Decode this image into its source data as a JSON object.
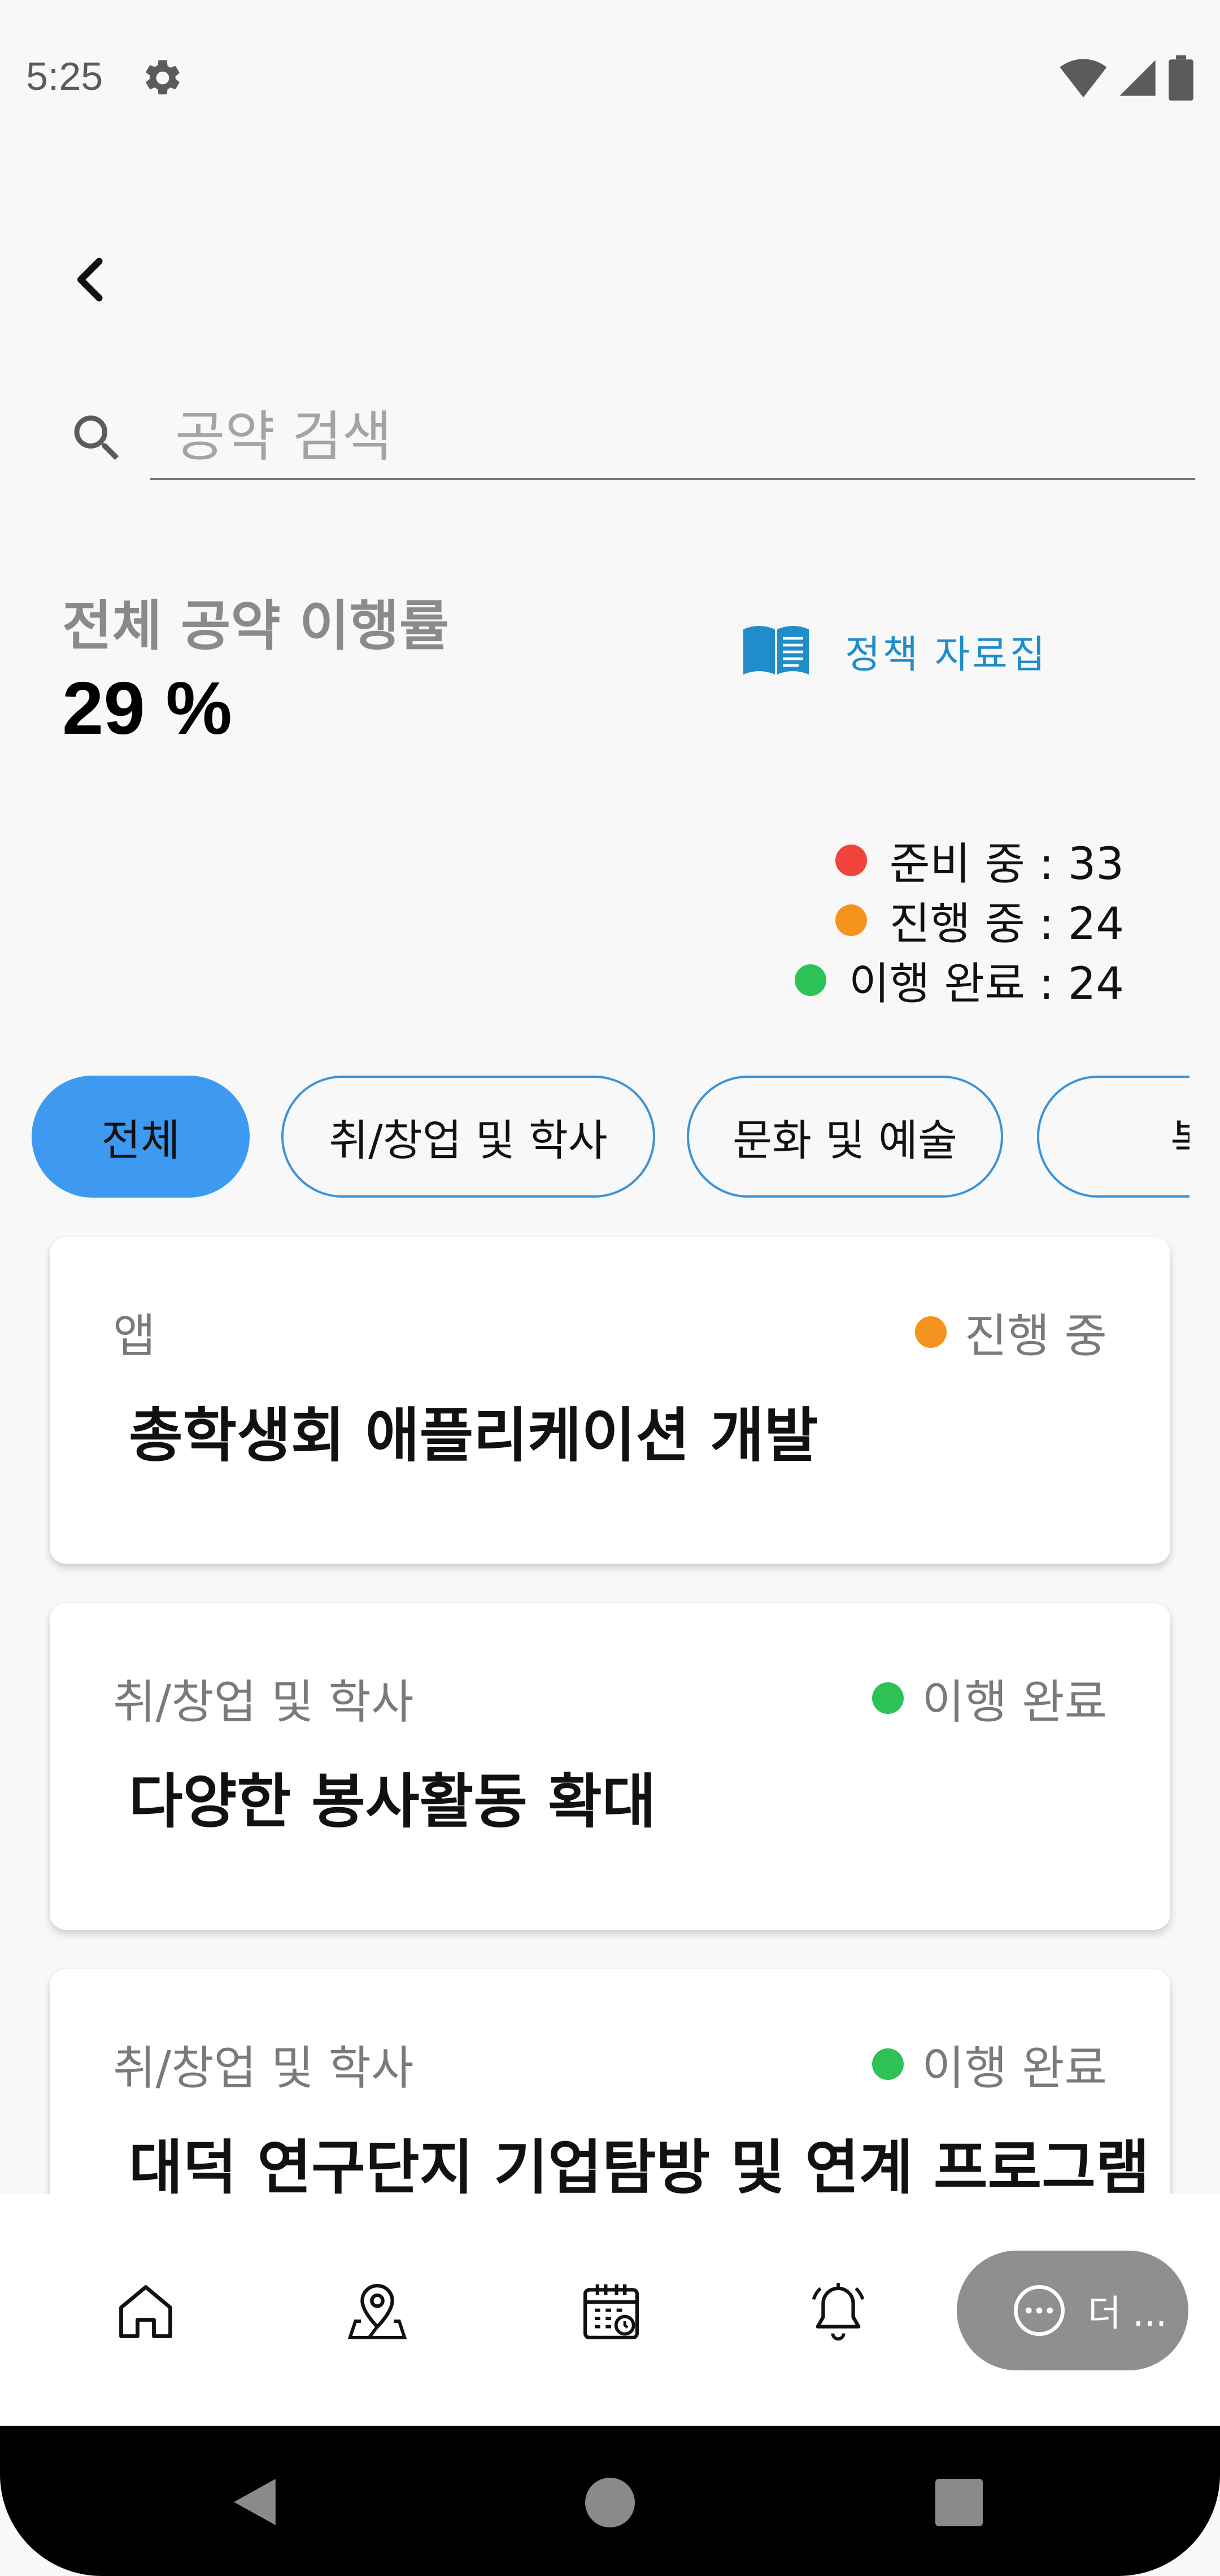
{
  "status_bar": {
    "time": "5:25"
  },
  "search": {
    "placeholder": "공약 검색"
  },
  "summary": {
    "rate_label": "전체 공약 이행률",
    "rate_value": "29 %",
    "policy_link": "정책 자료집"
  },
  "legend": [
    {
      "label": "준비 중 : 33",
      "color": "#f0443a"
    },
    {
      "label": "진행 중 : 24",
      "color": "#f5931f"
    },
    {
      "label": "이행 완료 : 24",
      "color": "#2ec256"
    }
  ],
  "chips": [
    {
      "label": "전체",
      "active": true
    },
    {
      "label": "취/창업 및 학사",
      "active": false
    },
    {
      "label": "문화 및 예술",
      "active": false
    },
    {
      "label": "복지",
      "active": false
    }
  ],
  "cards": [
    {
      "category": "앱",
      "status": "진행 중",
      "status_color": "#f5931f",
      "title": "총학생회 애플리케이션 개발"
    },
    {
      "category": "취/창업 및 학사",
      "status": "이행 완료",
      "status_color": "#2ec256",
      "title": "다양한 봉사활동 확대"
    },
    {
      "category": "취/창업 및 학사",
      "status": "이행 완료",
      "status_color": "#2ec256",
      "title": "대덕 연구단지 기업탐방 및 연계 프로그램"
    }
  ],
  "bottom_nav": {
    "items": [
      "home-icon",
      "map-pin-icon",
      "calendar-icon",
      "bell-icon"
    ],
    "more_label": "더 ..."
  }
}
